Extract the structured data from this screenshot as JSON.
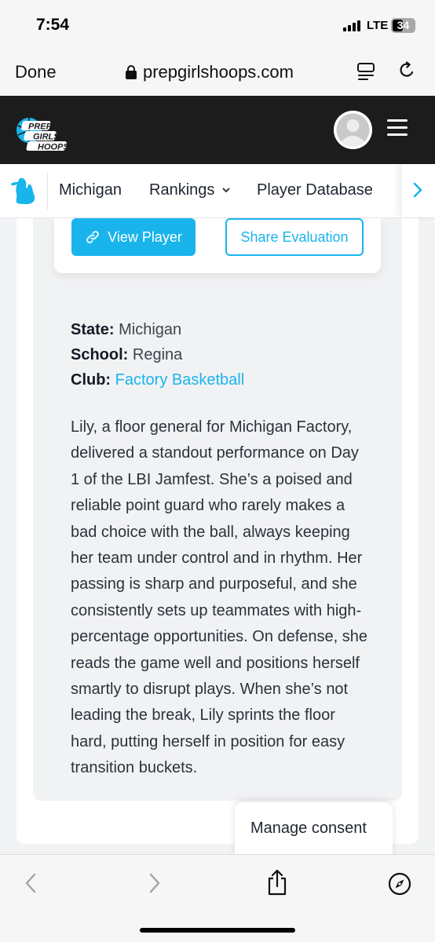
{
  "status_bar": {
    "time": "7:54",
    "network": "LTE",
    "battery": "34"
  },
  "browser": {
    "done_label": "Done",
    "url": "prepgirlshoops.com"
  },
  "site": {
    "logo_lines": [
      "PREP",
      "GIRLS",
      "HOOPS"
    ],
    "nav": [
      {
        "label": "Michigan"
      },
      {
        "label": "Rankings",
        "has_dropdown": true
      },
      {
        "label": "Player Database"
      }
    ]
  },
  "player_actions": {
    "view_label": "View Player",
    "share_label": "Share Evaluation"
  },
  "player_info": {
    "state_label": "State:",
    "state_value": "Michigan",
    "school_label": "School:",
    "school_value": "Regina",
    "club_label": "Club:",
    "club_value": "Factory Basketball"
  },
  "evaluation": {
    "lines": [
      "Lily, a floor general for Michigan Factory,",
      "delivered a standout performance on Day",
      "1 of the LBI Jamfest. She’s a poised and",
      "reliable point guard who rarely makes a",
      "bad choice with the ball, always keeping",
      "her team under control and in rhythm. Her",
      "passing is sharp and purposeful, and she",
      "consistently sets up teammates with high-",
      "percentage opportunities. On defense, she",
      "reads the game well and positions herself",
      "smartly to disrupt plays. When she’s not",
      "leading the break, Lily sprints the floor",
      "hard, putting herself in position for easy",
      "transition buckets."
    ]
  },
  "consent": {
    "label": "Manage consent"
  },
  "colors": {
    "accent": "#19b4eb",
    "header_bg": "#1c1c1c"
  }
}
